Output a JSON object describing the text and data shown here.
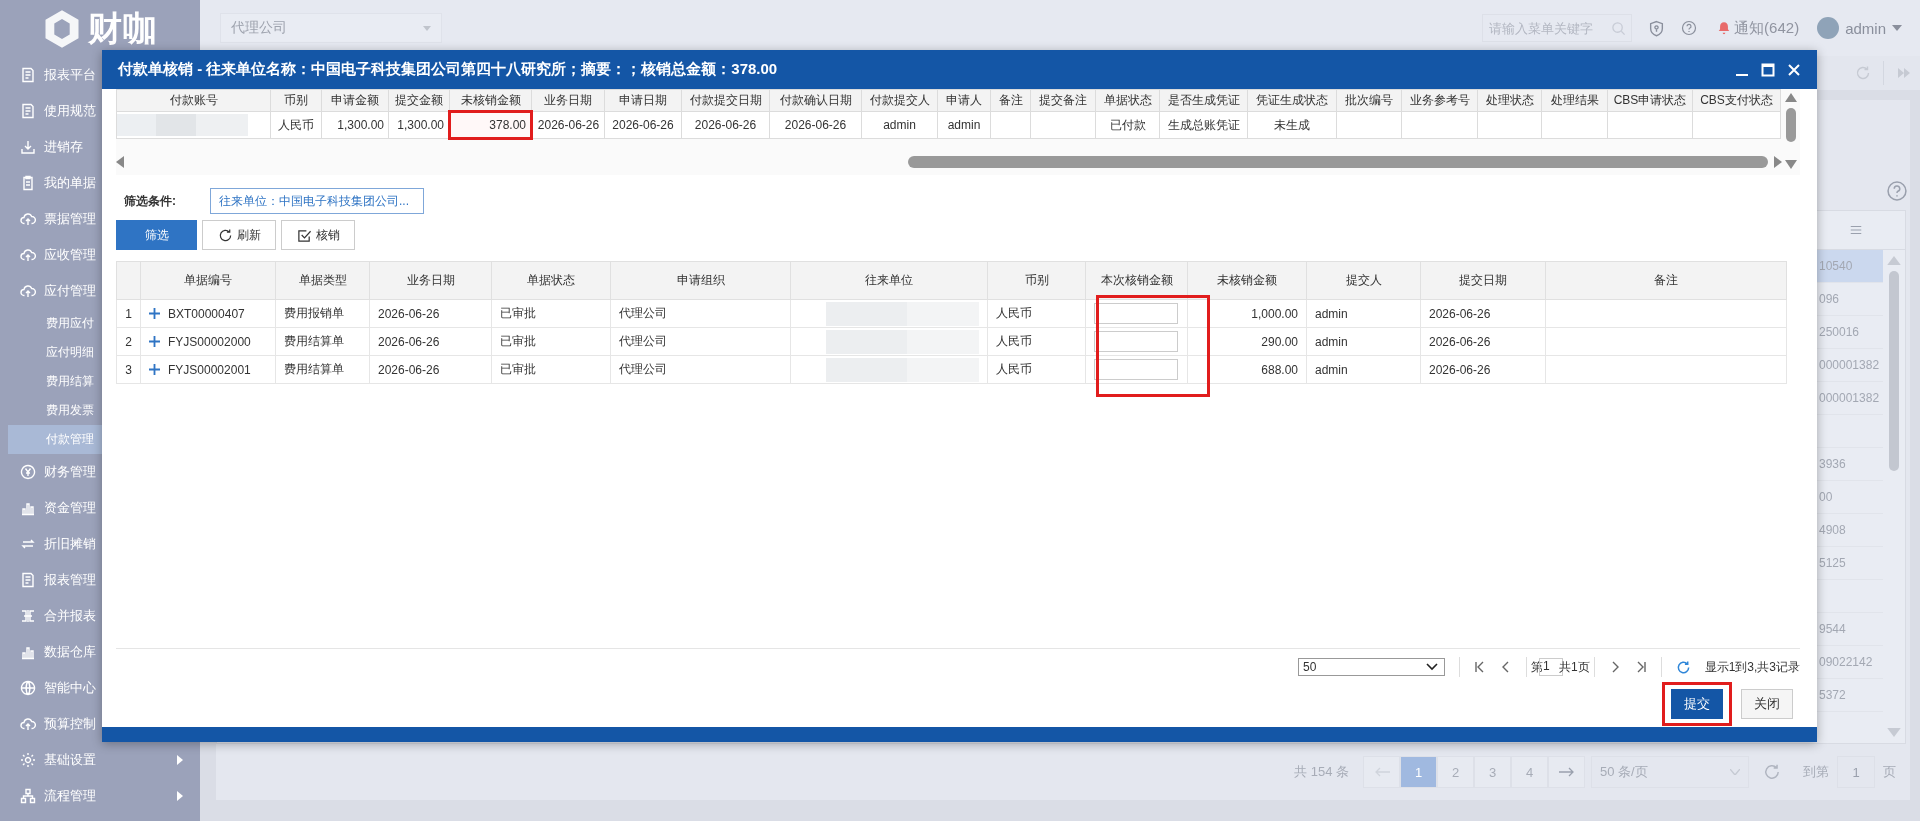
{
  "app": {
    "logo": "财咖",
    "company": "代理公司",
    "search_placeholder": "请输入菜单关键字",
    "notifications": "通知(642)",
    "user": "admin"
  },
  "sidebar": {
    "items": [
      {
        "label": "报表平台"
      },
      {
        "label": "使用规范"
      },
      {
        "label": "进销存"
      },
      {
        "label": "我的单据"
      },
      {
        "label": "票据管理"
      },
      {
        "label": "应收管理"
      },
      {
        "label": "应付管理",
        "children": [
          {
            "label": "费用应付",
            "selected": false
          },
          {
            "label": "应付明细",
            "selected": false
          },
          {
            "label": "费用结算",
            "selected": false
          },
          {
            "label": "费用发票",
            "selected": false
          },
          {
            "label": "付款管理",
            "selected": true
          }
        ]
      },
      {
        "label": "财务管理"
      },
      {
        "label": "资金管理"
      },
      {
        "label": "折旧摊销"
      },
      {
        "label": "报表管理"
      },
      {
        "label": "合并报表"
      },
      {
        "label": "数据仓库"
      },
      {
        "label": "智能中心"
      },
      {
        "label": "预算控制"
      },
      {
        "label": "基础设置",
        "expandable": true
      },
      {
        "label": "流程管理",
        "expandable": true
      }
    ]
  },
  "modal": {
    "title": "付款单核销 - 往来单位名称：中国电子科技集团公司第四十八研究所；摘要：；核销总金额：378.00",
    "top_table": {
      "columns": [
        "付款账号",
        "币别",
        "申请金额",
        "提交金额",
        "未核销金额",
        "业务日期",
        "申请日期",
        "付款提交日期",
        "付款确认日期",
        "付款提交人",
        "申请人",
        "备注",
        "提交备注",
        "单据状态",
        "是否生成凭证",
        "凭证生成状态",
        "批次编号",
        "业务参考号",
        "处理状态",
        "处理结果",
        "CBS申请状态",
        "CBS支付状态"
      ],
      "rows": [
        {
          "cells": [
            {
              "kind": "redacted",
              "highlighted": false
            },
            {
              "kind": "text",
              "text": "人民币",
              "highlighted": false
            },
            {
              "kind": "amount",
              "text": "1,300.00",
              "highlighted": false
            },
            {
              "kind": "amount",
              "text": "1,300.00",
              "highlighted": false
            },
            {
              "kind": "amount",
              "text": "378.00",
              "highlighted": true
            },
            {
              "kind": "text",
              "text": "2026-06-26",
              "highlighted": false
            },
            {
              "kind": "text",
              "text": "2026-06-26",
              "highlighted": false
            },
            {
              "kind": "text",
              "text": "2026-06-26",
              "highlighted": false
            },
            {
              "kind": "text",
              "text": "2026-06-26",
              "highlighted": false
            },
            {
              "kind": "text",
              "text": "admin",
              "highlighted": false
            },
            {
              "kind": "text",
              "text": "admin",
              "highlighted": false
            },
            {
              "kind": "empty",
              "highlighted": false
            },
            {
              "kind": "empty",
              "highlighted": false
            },
            {
              "kind": "text",
              "text": "已付款",
              "highlighted": false
            },
            {
              "kind": "text",
              "text": "生成总账凭证",
              "highlighted": false
            },
            {
              "kind": "text",
              "text": "未生成",
              "highlighted": false
            },
            {
              "kind": "empty",
              "highlighted": false
            },
            {
              "kind": "empty",
              "highlighted": false
            },
            {
              "kind": "empty",
              "highlighted": false
            },
            {
              "kind": "empty",
              "highlighted": false
            },
            {
              "kind": "empty",
              "highlighted": false
            },
            {
              "kind": "empty",
              "highlighted": false
            }
          ]
        }
      ]
    },
    "filter": {
      "label": "筛选条件:",
      "value": "往来单位：中国电子科技集团公司...",
      "buttons": [
        {
          "label": "筛选",
          "kind": "primary"
        },
        {
          "label": "刷新",
          "kind": "refresh"
        },
        {
          "label": "核销",
          "kind": "check"
        }
      ]
    },
    "lower_table": {
      "columns": [
        {
          "label": "单据编号",
          "highlighted": false
        },
        {
          "label": "单据类型",
          "highlighted": false
        },
        {
          "label": "业务日期",
          "highlighted": false
        },
        {
          "label": "单据状态",
          "highlighted": false
        },
        {
          "label": "申请组织",
          "highlighted": false
        },
        {
          "label": "往来单位",
          "highlighted": false
        },
        {
          "label": "币别",
          "highlighted": false
        },
        {
          "label": "本次核销金额",
          "highlighted": true
        },
        {
          "label": "未核销金额",
          "highlighted": false
        },
        {
          "label": "提交人",
          "highlighted": false
        },
        {
          "label": "提交日期",
          "highlighted": false
        },
        {
          "label": "备注",
          "highlighted": false
        }
      ],
      "rows": [
        {
          "index": "1",
          "number": "BXT00000407",
          "type": "费用报销单",
          "business_date": "2026-06-26",
          "status": "已审批",
          "org": "代理公司",
          "currency": "人民币",
          "unpaid": "1,000.00",
          "submitter": "admin",
          "submit_date": "2026-06-26"
        },
        {
          "index": "2",
          "number": "FYJS00002000",
          "type": "费用结算单",
          "business_date": "2026-06-26",
          "status": "已审批",
          "org": "代理公司",
          "currency": "人民币",
          "unpaid": "290.00",
          "submitter": "admin",
          "submit_date": "2026-06-26"
        },
        {
          "index": "3",
          "number": "FYJS00002001",
          "type": "费用结算单",
          "business_date": "2026-06-26",
          "status": "已审批",
          "org": "代理公司",
          "currency": "人民币",
          "unpaid": "688.00",
          "submitter": "admin",
          "submit_date": "2026-06-26"
        }
      ]
    },
    "pager": {
      "page_size": "50",
      "page_prefix": "第",
      "page": "1",
      "total_pages": "共1页",
      "summary": "显示1到3,共3记录"
    },
    "footer_buttons": [
      {
        "label": "提交",
        "kind": "primary",
        "highlighted": true
      },
      {
        "label": "关闭",
        "kind": "default",
        "highlighted": false
      }
    ]
  },
  "background": {
    "rows": [
      {
        "text": "10540",
        "selected": true
      },
      {
        "text": "096",
        "selected": false
      },
      {
        "text": "250016",
        "selected": false
      },
      {
        "text": "000001382",
        "selected": false
      },
      {
        "text": "000001382",
        "selected": false
      },
      {
        "selected": false
      },
      {
        "text": "3936",
        "selected": false
      },
      {
        "text": "00",
        "selected": false
      },
      {
        "text": "4908",
        "selected": false
      },
      {
        "text": "5125",
        "selected": false
      },
      {
        "selected": false
      },
      {
        "text": "9544",
        "selected": false
      },
      {
        "text": "09022142",
        "selected": false
      },
      {
        "text": "5372",
        "selected": false
      }
    ],
    "pager": {
      "total": "共 154 条",
      "pages": [
        {
          "label": "1",
          "selected": true
        },
        {
          "label": "2",
          "selected": false
        },
        {
          "label": "3",
          "selected": false
        },
        {
          "label": "4",
          "selected": false
        }
      ],
      "page_size": "50 条/页",
      "goto_label": "到第",
      "goto_value": "1",
      "page_unit": "页"
    }
  }
}
